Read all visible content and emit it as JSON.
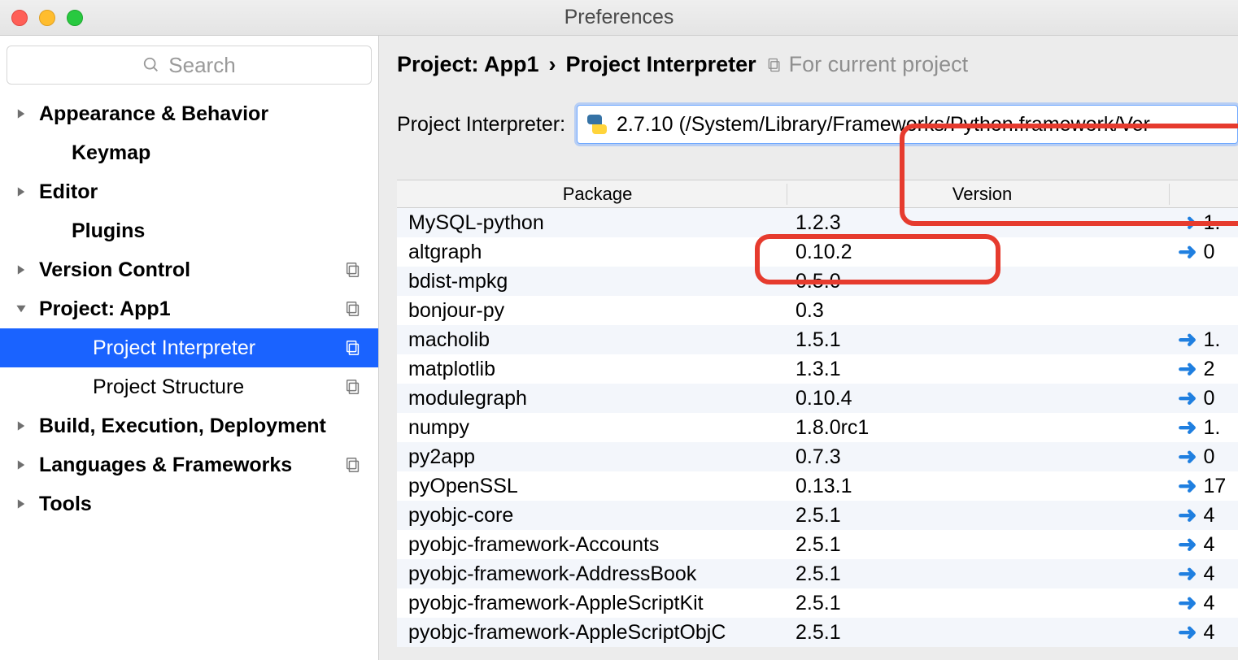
{
  "window": {
    "title": "Preferences"
  },
  "search": {
    "placeholder": "Search"
  },
  "sidebar": {
    "items": [
      {
        "label": "Appearance & Behavior",
        "expandable": true,
        "expanded": false,
        "bold": true,
        "indent": 0,
        "copy": false
      },
      {
        "label": "Keymap",
        "expandable": false,
        "bold": true,
        "indent": 1,
        "copy": false
      },
      {
        "label": "Editor",
        "expandable": true,
        "expanded": false,
        "bold": true,
        "indent": 0,
        "copy": false
      },
      {
        "label": "Plugins",
        "expandable": false,
        "bold": true,
        "indent": 1,
        "copy": false
      },
      {
        "label": "Version Control",
        "expandable": true,
        "expanded": false,
        "bold": true,
        "indent": 0,
        "copy": true
      },
      {
        "label": "Project: App1",
        "expandable": true,
        "expanded": true,
        "bold": true,
        "indent": 0,
        "copy": true
      },
      {
        "label": "Project Interpreter",
        "expandable": false,
        "bold": false,
        "indent": 2,
        "copy": true,
        "selected": true
      },
      {
        "label": "Project Structure",
        "expandable": false,
        "bold": false,
        "indent": 2,
        "copy": true
      },
      {
        "label": "Build, Execution, Deployment",
        "expandable": true,
        "expanded": false,
        "bold": true,
        "indent": 0,
        "copy": false
      },
      {
        "label": "Languages & Frameworks",
        "expandable": true,
        "expanded": false,
        "bold": true,
        "indent": 0,
        "copy": true
      },
      {
        "label": "Tools",
        "expandable": true,
        "expanded": false,
        "bold": true,
        "indent": 0,
        "copy": false
      }
    ]
  },
  "breadcrumb": {
    "root": "Project: App1",
    "sep": "›",
    "current": "Project Interpreter",
    "sub": "For current project"
  },
  "interpreter": {
    "label": "Project Interpreter:",
    "value": "2.7.10 (/System/Library/Frameworks/Python.framework/Ver"
  },
  "table": {
    "headers": {
      "package": "Package",
      "version": "Version",
      "latest": ""
    },
    "rows": [
      {
        "package": "MySQL-python",
        "version": "1.2.3",
        "hasUpdate": true,
        "latest": "1."
      },
      {
        "package": "altgraph",
        "version": "0.10.2",
        "hasUpdate": true,
        "latest": "0"
      },
      {
        "package": "bdist-mpkg",
        "version": "0.5.0",
        "hasUpdate": false,
        "latest": ""
      },
      {
        "package": "bonjour-py",
        "version": "0.3",
        "hasUpdate": false,
        "latest": ""
      },
      {
        "package": "macholib",
        "version": "1.5.1",
        "hasUpdate": true,
        "latest": "1."
      },
      {
        "package": "matplotlib",
        "version": "1.3.1",
        "hasUpdate": true,
        "latest": "2"
      },
      {
        "package": "modulegraph",
        "version": "0.10.4",
        "hasUpdate": true,
        "latest": "0"
      },
      {
        "package": "numpy",
        "version": "1.8.0rc1",
        "hasUpdate": true,
        "latest": "1."
      },
      {
        "package": "py2app",
        "version": "0.7.3",
        "hasUpdate": true,
        "latest": "0"
      },
      {
        "package": "pyOpenSSL",
        "version": "0.13.1",
        "hasUpdate": true,
        "latest": "17"
      },
      {
        "package": "pyobjc-core",
        "version": "2.5.1",
        "hasUpdate": true,
        "latest": "4"
      },
      {
        "package": "pyobjc-framework-Accounts",
        "version": "2.5.1",
        "hasUpdate": true,
        "latest": "4"
      },
      {
        "package": "pyobjc-framework-AddressBook",
        "version": "2.5.1",
        "hasUpdate": true,
        "latest": "4"
      },
      {
        "package": "pyobjc-framework-AppleScriptKit",
        "version": "2.5.1",
        "hasUpdate": true,
        "latest": "4"
      },
      {
        "package": "pyobjc-framework-AppleScriptObjC",
        "version": "2.5.1",
        "hasUpdate": true,
        "latest": "4"
      }
    ]
  }
}
